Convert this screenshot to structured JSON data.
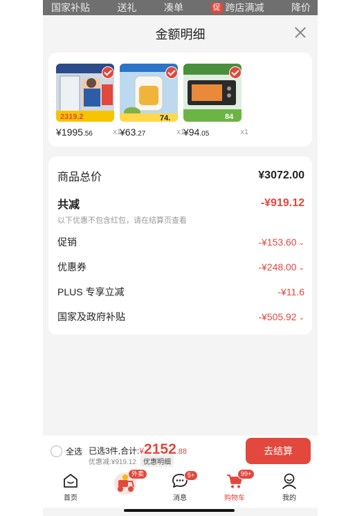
{
  "top_strip": {
    "items": [
      "国家补贴",
      "送礼",
      "凑单",
      "跨店满减",
      "降价"
    ],
    "promo_badge": "促"
  },
  "sheet": {
    "title": "金额明细"
  },
  "products": [
    {
      "price_int": "¥1995",
      "price_dec": ".56",
      "qty": "x1"
    },
    {
      "price_int": "¥63",
      "price_dec": ".27",
      "qty": "x1"
    },
    {
      "price_int": "¥94",
      "price_dec": ".05",
      "qty": "x1"
    }
  ],
  "product_images": [
    {
      "label": "2319.2"
    },
    {
      "label": "74."
    },
    {
      "label": "84"
    }
  ],
  "summary": {
    "total_label": "商品总价",
    "total_value": "¥3072.00",
    "reduce_label": "共减",
    "reduce_value": "-¥919.12",
    "note": "以下优惠不包含红包，请在结算页查看",
    "rows": [
      {
        "label": "促销",
        "value": "-¥153.60"
      },
      {
        "label": "优惠券",
        "value": "-¥248.00"
      },
      {
        "label": "PLUS 专享立减",
        "value": "-¥11.6"
      },
      {
        "label": "国家及政府补贴",
        "value": "-¥505.92"
      }
    ]
  },
  "bottom": {
    "select_all": "全选",
    "selected_text": "已选3件,合计:",
    "yen": "¥",
    "price_int": "2152",
    "price_dec": ".88",
    "discount": "优惠减:¥919.12",
    "detail_tag": "优惠明细",
    "checkout": "去结算"
  },
  "tabs": [
    {
      "label": "首页",
      "icon": "home-icon"
    },
    {
      "label": "",
      "icon": "delivery-icon",
      "badge": "外卖"
    },
    {
      "label": "消息",
      "icon": "message-icon",
      "badge": "5+"
    },
    {
      "label": "购物车",
      "icon": "cart-icon",
      "badge": "99+"
    },
    {
      "label": "我的",
      "icon": "profile-icon"
    }
  ],
  "colors": {
    "accent": "#e2483d",
    "background": "#f4f4f4"
  }
}
